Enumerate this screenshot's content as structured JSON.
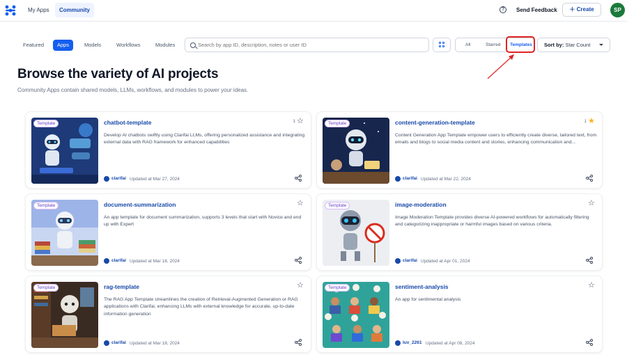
{
  "nav": {
    "my_apps": "My Apps",
    "community": "Community",
    "send_feedback": "Send Feedback",
    "create": "Create",
    "avatar_initials": "SP"
  },
  "filters": {
    "tabs": [
      "Featured",
      "Apps",
      "Models",
      "Workflows",
      "Modules"
    ],
    "active_tab": "Apps",
    "search_placeholder": "Search by app ID, description, notes or user ID",
    "segments": [
      "All",
      "Starred",
      "Templates"
    ],
    "active_segment": "Templates",
    "sort_label": "Sort by:",
    "sort_value": "Star Count"
  },
  "page": {
    "title": "Browse the variety of AI projects",
    "subtitle": "Community Apps contain shared models, LLMs, workflows, and modules to power your ideas."
  },
  "cards": [
    {
      "badge": "Template",
      "title": "chatbot-template",
      "description": "Develop AI chatbots swiftly using Clarifai LLMs, offering personalized assistance and integrating external data with RAG framework for enhanced capabilities",
      "star_count": "1",
      "starred": false,
      "owner": "clarifai",
      "updated": "Updated at Mar 27, 2024"
    },
    {
      "badge": "Template",
      "title": "content-generation-template",
      "description": "Content Generation App Template empower users to efficiently create diverse, tailored text, from emails and blogs to social media content and stories, enhancing communication and...",
      "star_count": "1",
      "starred": true,
      "owner": "clarifai",
      "updated": "Updated at Mar 22, 2024"
    },
    {
      "badge": "Template",
      "title": "document-summarization",
      "description": "An app template for document summarization, supports 3 levels that start with Novice and end up with Expert",
      "star_count": "",
      "starred": false,
      "owner": "clarifai",
      "updated": "Updated at Mar 18, 2024"
    },
    {
      "badge": "Template",
      "title": "image-moderation",
      "description": "Image Moderation Template provides diverse AI-powered workflows for automatically filtering and categorizing inappropriate or harmful images based on various criteria.",
      "star_count": "",
      "starred": false,
      "owner": "clarifai",
      "updated": "Updated at Apr 01, 2024"
    },
    {
      "badge": "Template",
      "title": "rag-template",
      "description": "The RAG App Template streamlines the creation of Retrieval-Augmented Generation or RAG applications with Clarifai, enhancing LLMs with external knowledge for accurate, up-to-date information generation",
      "star_count": "",
      "starred": false,
      "owner": "clarifai",
      "updated": "Updated at Mar 18, 2024"
    },
    {
      "badge": "Template",
      "title": "sentiment-analysis",
      "description": "An app for sentimental analysis",
      "star_count": "",
      "starred": false,
      "owner": "luv_2261",
      "updated": "Updated at Apr 08, 2024"
    }
  ],
  "colors": {
    "accent": "#155eef",
    "link": "#1849a9",
    "highlight": "#e02424",
    "star_filled": "#fdb022"
  }
}
